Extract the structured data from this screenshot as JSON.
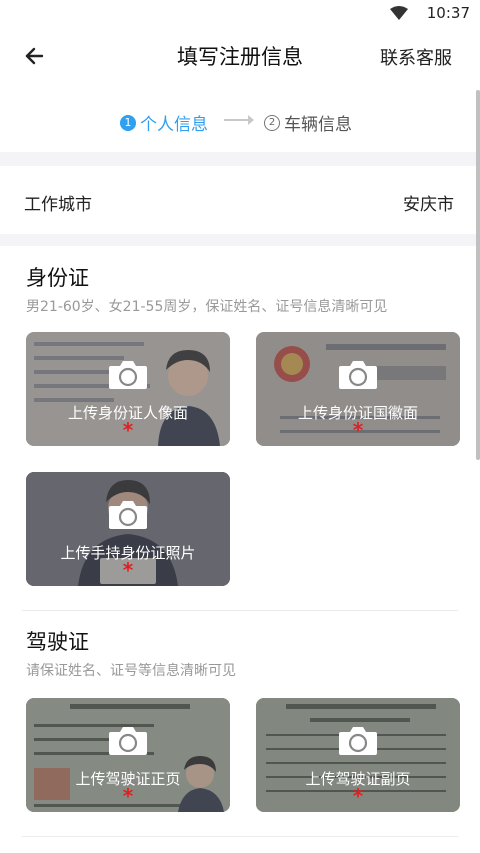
{
  "status": {
    "time": "10:37"
  },
  "header": {
    "title": "填写注册信息",
    "contact": "联系客服"
  },
  "steps": [
    {
      "num": "1",
      "label": "个人信息"
    },
    {
      "num": "2",
      "label": "车辆信息"
    }
  ],
  "city": {
    "label": "工作城市",
    "value": "安庆市"
  },
  "id_card": {
    "title": "身份证",
    "desc": "男21-60岁、女21-55周岁，保证姓名、证号信息清晰可见",
    "uploads": [
      "上传身份证人像面",
      "上传身份证国徽面",
      "上传手持身份证照片"
    ]
  },
  "license": {
    "title": "驾驶证",
    "desc": "请保证姓名、证号等信息清晰可见",
    "uploads": [
      "上传驾驶证正页",
      "上传驾驶证副页"
    ]
  },
  "required_mark": "*",
  "colors": {
    "accent": "#2f9ff1",
    "required": "#e02020"
  }
}
